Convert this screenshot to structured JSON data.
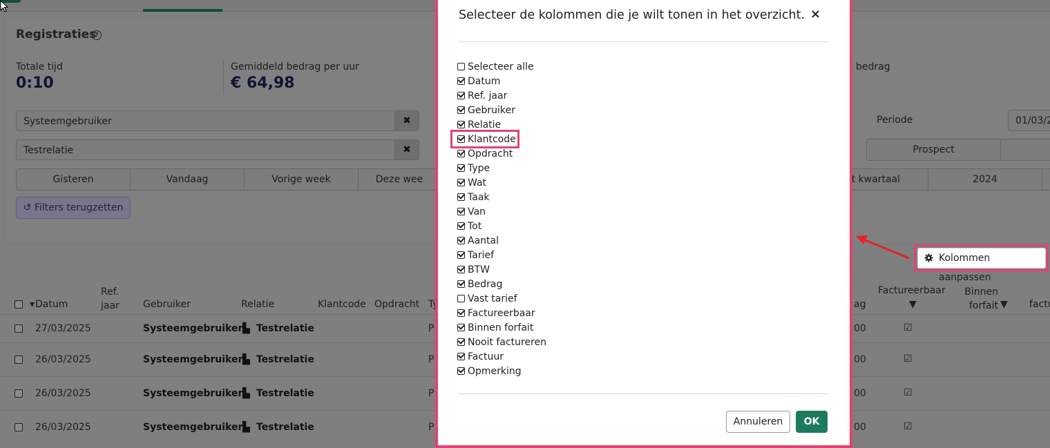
{
  "page": {
    "title": "Registraties",
    "stats": [
      {
        "label": "Totale tijd",
        "value": "0:10"
      },
      {
        "label": "Gemiddeld bedrag per uur",
        "value": "€ 64,98"
      },
      {
        "label": "bedrag",
        "value": ""
      }
    ],
    "filters": {
      "user_value": "Systeemgebruiker",
      "relation_value": "Testrelatie",
      "period_label": "Periode",
      "period_value": "01/03/2",
      "prospect_label": "Prospect",
      "ranges": [
        "Gisteren",
        "Vandaag",
        "Vorige week",
        "Deze wee",
        "t kwartaal",
        "2024"
      ],
      "reset_label": "Filters terugzetten"
    },
    "columns_button": "Kolommen aanpassen",
    "table": {
      "headers": {
        "datum": "Datum",
        "ref_jaar": "Ref. jaar",
        "gebruiker": "Gebruiker",
        "relatie": "Relatie",
        "klantcode": "Klantcode",
        "opdracht": "Opdracht",
        "type": "Ty",
        "bedrag": "ag",
        "factureerbaar": "Factureerbaar",
        "binnen_forfait": "Binnen forfait",
        "factuur": "factu"
      },
      "rows": [
        {
          "datum": "27/03/2025",
          "gebruiker": "Systeemgebruiker",
          "relatie": "Testrelatie",
          "type": "P",
          "bedrag": "00"
        },
        {
          "datum": "26/03/2025",
          "gebruiker": "Systeemgebruiker",
          "relatie": "Testrelatie",
          "type": "P",
          "bedrag": "00"
        },
        {
          "datum": "26/03/2025",
          "gebruiker": "Systeemgebruiker",
          "relatie": "Testrelatie",
          "type": "P",
          "bedrag": "00"
        },
        {
          "datum": "26/03/2025",
          "gebruiker": "Systeemgebruiker",
          "relatie": "Testrelatie",
          "type": "P",
          "bedrag": "00"
        }
      ]
    }
  },
  "modal": {
    "title": "Selecteer de kolommen die je wilt tonen in het overzicht.",
    "close": "×",
    "options": [
      {
        "label": "Selecteer alle",
        "checked": false
      },
      {
        "label": "Datum",
        "checked": true
      },
      {
        "label": "Ref. jaar",
        "checked": true
      },
      {
        "label": "Gebruiker",
        "checked": true
      },
      {
        "label": "Relatie",
        "checked": true
      },
      {
        "label": "Klantcode",
        "checked": true
      },
      {
        "label": "Opdracht",
        "checked": true
      },
      {
        "label": "Type",
        "checked": true
      },
      {
        "label": "Wat",
        "checked": true
      },
      {
        "label": "Taak",
        "checked": true
      },
      {
        "label": "Van",
        "checked": true
      },
      {
        "label": "Tot",
        "checked": true
      },
      {
        "label": "Aantal",
        "checked": true
      },
      {
        "label": "Tarief",
        "checked": true
      },
      {
        "label": "BTW",
        "checked": true
      },
      {
        "label": "Bedrag",
        "checked": true
      },
      {
        "label": "Vast tarief",
        "checked": false
      },
      {
        "label": "Factureerbaar",
        "checked": true
      },
      {
        "label": "Binnen forfait",
        "checked": true
      },
      {
        "label": "Nooit factureren",
        "checked": true
      },
      {
        "label": "Factuur",
        "checked": true
      },
      {
        "label": "Opmerking",
        "checked": true
      }
    ],
    "cancel_label": "Annuleren",
    "ok_label": "OK"
  },
  "colors": {
    "highlight": "#e0446f",
    "primary": "#1d7a5f",
    "overlay": "#7f7f7f"
  }
}
